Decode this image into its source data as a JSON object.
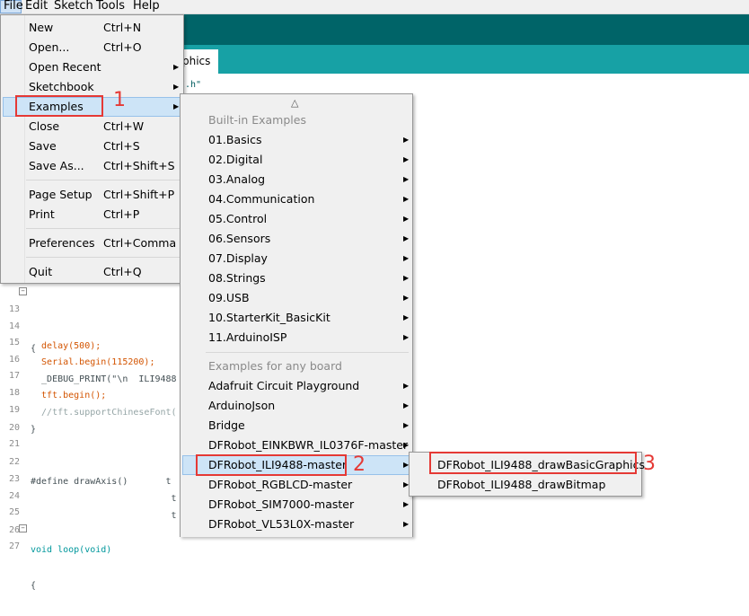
{
  "menubar": {
    "items": [
      "File",
      "Edit",
      "Sketch",
      "Tools",
      "Help"
    ]
  },
  "ide": {
    "tab_label": "phics",
    "header_code_fragment": "I.h\"",
    "lines": [
      {
        "num": "13",
        "text": "{"
      },
      {
        "num": "14",
        "text": "  delay(500);"
      },
      {
        "num": "15",
        "text": "  Serial.begin(115200);"
      },
      {
        "num": "16",
        "text": "  _DEBUG_PRINT(\"\\n  ILI9488"
      },
      {
        "num": "17",
        "text": "  tft.begin();"
      },
      {
        "num": "18",
        "text": "  //tft.supportChineseFont("
      },
      {
        "num": "19",
        "text": "}"
      },
      {
        "num": "20",
        "text": ""
      },
      {
        "num": "21",
        "text": ""
      },
      {
        "num": "22",
        "text": "#define drawAxis()       t"
      },
      {
        "num": "23",
        "text": "                          t"
      },
      {
        "num": "24",
        "text": "                          t"
      },
      {
        "num": "25",
        "text": ""
      },
      {
        "num": "26",
        "text": "void loop(void)"
      },
      {
        "num": "27",
        "text": "{"
      }
    ]
  },
  "file_menu": {
    "items": [
      {
        "label": "New",
        "shortcut": "Ctrl+N"
      },
      {
        "label": "Open...",
        "shortcut": "Ctrl+O"
      },
      {
        "label": "Open Recent",
        "shortcut": ""
      },
      {
        "label": "Sketchbook",
        "shortcut": ""
      },
      {
        "label": "Examples",
        "shortcut": ""
      },
      {
        "label": "Close",
        "shortcut": "Ctrl+W"
      },
      {
        "label": "Save",
        "shortcut": "Ctrl+S"
      },
      {
        "label": "Save As...",
        "shortcut": "Ctrl+Shift+S"
      },
      {
        "label": "Page Setup",
        "shortcut": "Ctrl+Shift+P"
      },
      {
        "label": "Print",
        "shortcut": "Ctrl+P"
      },
      {
        "label": "Preferences",
        "shortcut": "Ctrl+Comma"
      },
      {
        "label": "Quit",
        "shortcut": "Ctrl+Q"
      }
    ]
  },
  "examples_menu": {
    "scroll_up": "△",
    "builtin_header": "Built-in Examples",
    "builtin": [
      "01.Basics",
      "02.Digital",
      "03.Analog",
      "04.Communication",
      "05.Control",
      "06.Sensors",
      "07.Display",
      "08.Strings",
      "09.USB",
      "10.StarterKit_BasicKit",
      "11.ArduinoISP"
    ],
    "anyboard_header": "Examples for any board",
    "anyboard": [
      "Adafruit Circuit Playground",
      "ArduinoJson",
      "Bridge",
      "DFRobot_EINKBWR_IL0376F-master",
      "DFRobot_ILI9488-master",
      "DFRobot_RGBLCD-master",
      "DFRobot_SIM7000-master",
      "DFRobot_VL53L0X-master"
    ]
  },
  "ili_submenu": {
    "items": [
      "DFRobot_ILI9488_drawBasicGraphics",
      "DFRobot_ILI9488_drawBitmap"
    ]
  },
  "annotations": [
    "1",
    "2",
    "3"
  ],
  "colors": {
    "header": "#006468",
    "tabbar": "#17a1a5",
    "highlight": "#e53935",
    "selection": "#cde4f7"
  }
}
